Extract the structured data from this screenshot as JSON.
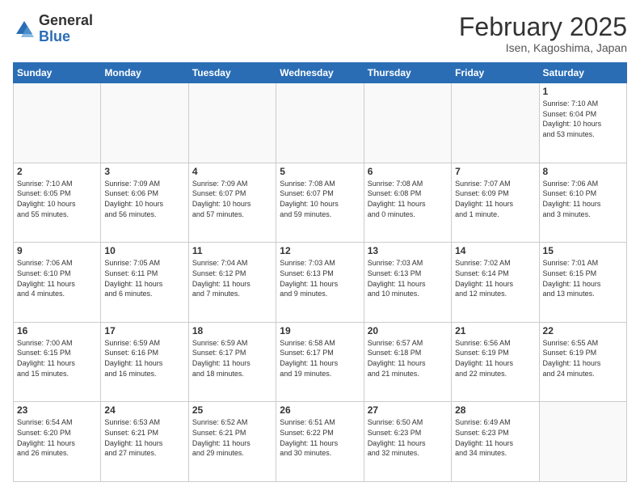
{
  "header": {
    "logo_general": "General",
    "logo_blue": "Blue",
    "month_title": "February 2025",
    "location": "Isen, Kagoshima, Japan"
  },
  "weekdays": [
    "Sunday",
    "Monday",
    "Tuesday",
    "Wednesday",
    "Thursday",
    "Friday",
    "Saturday"
  ],
  "weeks": [
    [
      {
        "day": "",
        "info": ""
      },
      {
        "day": "",
        "info": ""
      },
      {
        "day": "",
        "info": ""
      },
      {
        "day": "",
        "info": ""
      },
      {
        "day": "",
        "info": ""
      },
      {
        "day": "",
        "info": ""
      },
      {
        "day": "1",
        "info": "Sunrise: 7:10 AM\nSunset: 6:04 PM\nDaylight: 10 hours\nand 53 minutes."
      }
    ],
    [
      {
        "day": "2",
        "info": "Sunrise: 7:10 AM\nSunset: 6:05 PM\nDaylight: 10 hours\nand 55 minutes."
      },
      {
        "day": "3",
        "info": "Sunrise: 7:09 AM\nSunset: 6:06 PM\nDaylight: 10 hours\nand 56 minutes."
      },
      {
        "day": "4",
        "info": "Sunrise: 7:09 AM\nSunset: 6:07 PM\nDaylight: 10 hours\nand 57 minutes."
      },
      {
        "day": "5",
        "info": "Sunrise: 7:08 AM\nSunset: 6:07 PM\nDaylight: 10 hours\nand 59 minutes."
      },
      {
        "day": "6",
        "info": "Sunrise: 7:08 AM\nSunset: 6:08 PM\nDaylight: 11 hours\nand 0 minutes."
      },
      {
        "day": "7",
        "info": "Sunrise: 7:07 AM\nSunset: 6:09 PM\nDaylight: 11 hours\nand 1 minute."
      },
      {
        "day": "8",
        "info": "Sunrise: 7:06 AM\nSunset: 6:10 PM\nDaylight: 11 hours\nand 3 minutes."
      }
    ],
    [
      {
        "day": "9",
        "info": "Sunrise: 7:06 AM\nSunset: 6:10 PM\nDaylight: 11 hours\nand 4 minutes."
      },
      {
        "day": "10",
        "info": "Sunrise: 7:05 AM\nSunset: 6:11 PM\nDaylight: 11 hours\nand 6 minutes."
      },
      {
        "day": "11",
        "info": "Sunrise: 7:04 AM\nSunset: 6:12 PM\nDaylight: 11 hours\nand 7 minutes."
      },
      {
        "day": "12",
        "info": "Sunrise: 7:03 AM\nSunset: 6:13 PM\nDaylight: 11 hours\nand 9 minutes."
      },
      {
        "day": "13",
        "info": "Sunrise: 7:03 AM\nSunset: 6:13 PM\nDaylight: 11 hours\nand 10 minutes."
      },
      {
        "day": "14",
        "info": "Sunrise: 7:02 AM\nSunset: 6:14 PM\nDaylight: 11 hours\nand 12 minutes."
      },
      {
        "day": "15",
        "info": "Sunrise: 7:01 AM\nSunset: 6:15 PM\nDaylight: 11 hours\nand 13 minutes."
      }
    ],
    [
      {
        "day": "16",
        "info": "Sunrise: 7:00 AM\nSunset: 6:15 PM\nDaylight: 11 hours\nand 15 minutes."
      },
      {
        "day": "17",
        "info": "Sunrise: 6:59 AM\nSunset: 6:16 PM\nDaylight: 11 hours\nand 16 minutes."
      },
      {
        "day": "18",
        "info": "Sunrise: 6:59 AM\nSunset: 6:17 PM\nDaylight: 11 hours\nand 18 minutes."
      },
      {
        "day": "19",
        "info": "Sunrise: 6:58 AM\nSunset: 6:17 PM\nDaylight: 11 hours\nand 19 minutes."
      },
      {
        "day": "20",
        "info": "Sunrise: 6:57 AM\nSunset: 6:18 PM\nDaylight: 11 hours\nand 21 minutes."
      },
      {
        "day": "21",
        "info": "Sunrise: 6:56 AM\nSunset: 6:19 PM\nDaylight: 11 hours\nand 22 minutes."
      },
      {
        "day": "22",
        "info": "Sunrise: 6:55 AM\nSunset: 6:19 PM\nDaylight: 11 hours\nand 24 minutes."
      }
    ],
    [
      {
        "day": "23",
        "info": "Sunrise: 6:54 AM\nSunset: 6:20 PM\nDaylight: 11 hours\nand 26 minutes."
      },
      {
        "day": "24",
        "info": "Sunrise: 6:53 AM\nSunset: 6:21 PM\nDaylight: 11 hours\nand 27 minutes."
      },
      {
        "day": "25",
        "info": "Sunrise: 6:52 AM\nSunset: 6:21 PM\nDaylight: 11 hours\nand 29 minutes."
      },
      {
        "day": "26",
        "info": "Sunrise: 6:51 AM\nSunset: 6:22 PM\nDaylight: 11 hours\nand 30 minutes."
      },
      {
        "day": "27",
        "info": "Sunrise: 6:50 AM\nSunset: 6:23 PM\nDaylight: 11 hours\nand 32 minutes."
      },
      {
        "day": "28",
        "info": "Sunrise: 6:49 AM\nSunset: 6:23 PM\nDaylight: 11 hours\nand 34 minutes."
      },
      {
        "day": "",
        "info": ""
      }
    ]
  ]
}
